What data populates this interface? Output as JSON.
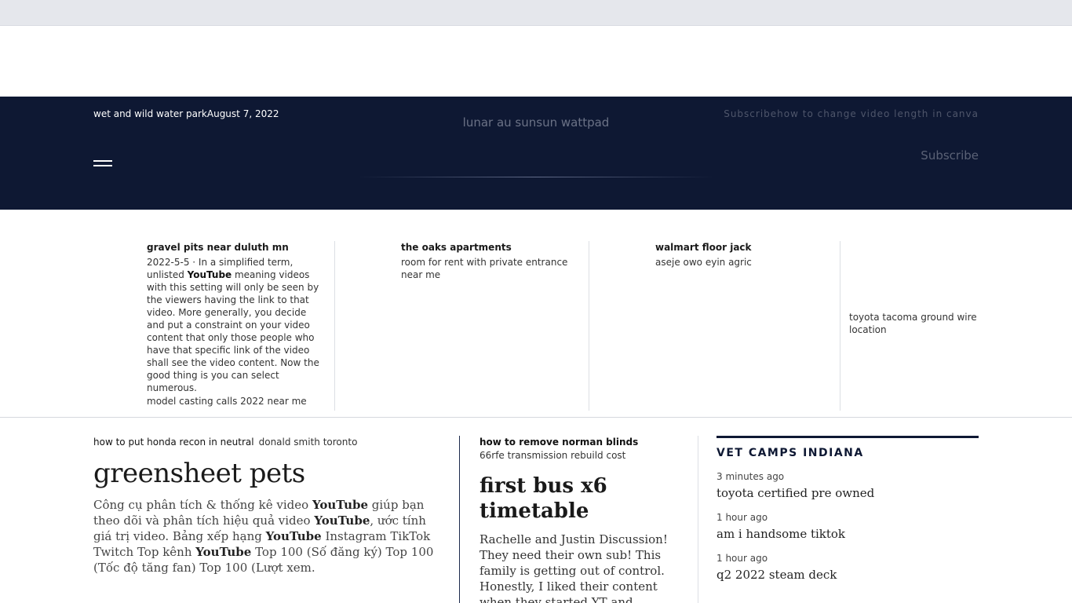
{
  "header": {
    "left_text": "wet and wild water parkAugust 7, 2022",
    "center_text": "lunar au sunsun wattpad",
    "right_top": "Subscribehow to change video length in canva",
    "right_subscribe": "Subscribe",
    "bg_color": "#0e1833"
  },
  "cards": [
    {
      "title": "gravel pits near duluth mn",
      "body_prefix": "2022-5-5 · In a simplified term, unlisted ",
      "body_bold": "YouTube",
      "body_suffix": " meaning videos with this setting will only be seen by the viewers having the link to that video. More generally, you decide and put a constraint on your video content that only those people who have that specific link of the video shall see the video content. Now the good thing is you can select numerous.",
      "footer": "model casting calls 2022 near me"
    },
    {
      "title": "the oaks apartments",
      "body": "room for rent with private entrance near me"
    },
    {
      "title": "walmart floor jack",
      "body": "aseje owo eyin agric"
    },
    {
      "body": "toyota tacoma ground wire location"
    }
  ],
  "main": {
    "tag_primary": "how to put honda recon in neutral",
    "tag_secondary": "donald smith toronto",
    "title": "greensheet pets",
    "body_parts": [
      "Công cụ phân tích & thống kê video ",
      "YouTube",
      " giúp bạn theo dõi và phân tích hiệu quả video ",
      "YouTube",
      ", ước tính giá trị video. Bảng xếp hạng ",
      "YouTube",
      " Instagram TikTok Twitch Top kênh ",
      "YouTube",
      " Top 100 (Số đăng ký) Top 100 (Tốc độ tăng fan) Top 100 (Lượt xem."
    ]
  },
  "middle": {
    "title": "how to remove norman blinds",
    "subtitle": "66rfe transmission rebuild cost",
    "big_title": "first bus x6 timetable",
    "body": "Rachelle and Justin Discussion! They need their own sub! This family is getting out of control. Honestly, I liked their content when they started YT and appreciated"
  },
  "sidebar": {
    "heading": "VET CAMPS INDIANA",
    "items": [
      {
        "time": "3 minutes ago",
        "text": "toyota certified pre owned"
      },
      {
        "time": "1 hour ago",
        "text": "am i handsome tiktok"
      },
      {
        "time": "1 hour ago",
        "text": "q2 2022 steam deck"
      }
    ]
  },
  "icons": {
    "menu": "hamburger-menu-icon"
  }
}
